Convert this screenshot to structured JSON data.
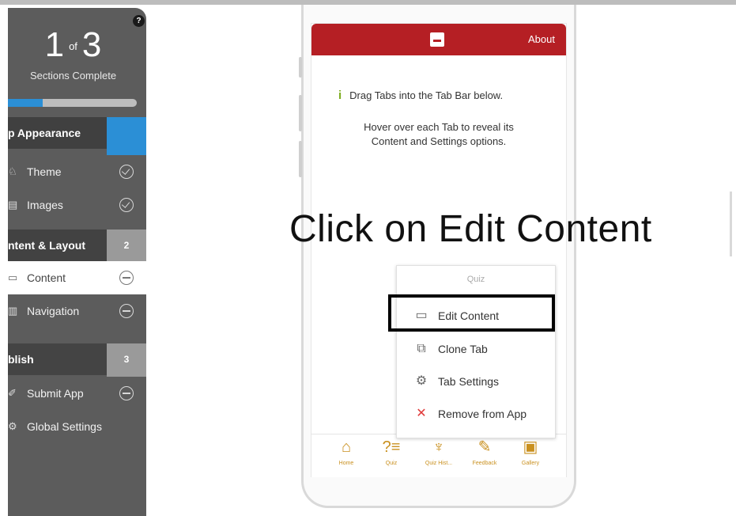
{
  "sidebar": {
    "help": "?",
    "progress": {
      "current": "1",
      "of": "of",
      "total": "3",
      "caption": "Sections Complete",
      "fraction": 0.27
    },
    "sections": [
      {
        "title": "p Appearance",
        "badge": "",
        "items": [
          {
            "label": "Theme",
            "icon": "brush-icon"
          },
          {
            "label": "Images",
            "icon": "image-icon"
          }
        ]
      },
      {
        "title": "ntent & Layout",
        "badge": "2",
        "items": [
          {
            "label": "Content",
            "icon": "content-icon"
          },
          {
            "label": "Navigation",
            "icon": "navigation-icon"
          }
        ]
      },
      {
        "title": "blish",
        "badge": "3",
        "items": [
          {
            "label": "Submit App",
            "icon": "pencil-icon"
          },
          {
            "label": "Global Settings",
            "icon": "gear-icon"
          }
        ]
      }
    ]
  },
  "phone": {
    "appbar": {
      "about": "About",
      "color": "#b51f24"
    },
    "hint_line": "Drag Tabs into the Tab Bar below.",
    "hint_para_1": "Hover over each Tab to reveal its",
    "hint_para_2": "Content and Settings options.",
    "tabs": [
      {
        "label": "Home",
        "icon": "home-icon"
      },
      {
        "label": "Quiz",
        "icon": "quiz-icon"
      },
      {
        "label": "Quiz Hist...",
        "icon": "trophy-icon"
      },
      {
        "label": "Feedback",
        "icon": "feedback-icon"
      },
      {
        "label": "Gallery",
        "icon": "gallery-icon"
      }
    ]
  },
  "menu": {
    "title": "Quiz",
    "items": [
      {
        "label": "Edit Content",
        "icon": "edit-content-icon"
      },
      {
        "label": "Clone Tab",
        "icon": "clone-icon"
      },
      {
        "label": "Tab Settings",
        "icon": "gears-icon"
      },
      {
        "label": "Remove from App",
        "icon": "remove-icon"
      }
    ]
  },
  "instruction": "Click on Edit Content",
  "colors": {
    "accent": "#2b8fd6",
    "brand": "#b51f24",
    "tab_icon": "#c9901f",
    "remove": "#e03a3a"
  }
}
